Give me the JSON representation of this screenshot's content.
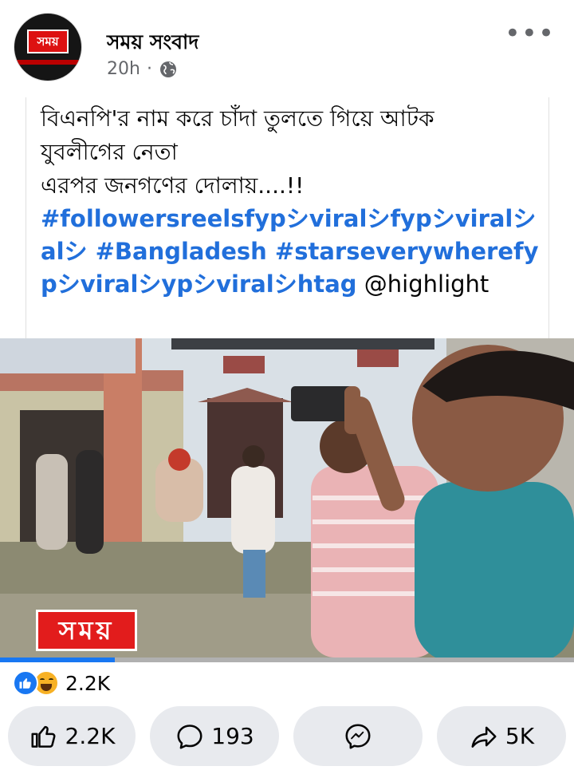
{
  "post": {
    "page_name": "সময় সংবাদ",
    "time": "20h",
    "separator": "·",
    "avatar_logo_text": "সময়",
    "caption_line1": "বিএনপি'র  নাম করে চাঁদা  তুলতে গিয়ে আটক",
    "caption_line2": "যুবলীগের নেতা",
    "caption_line3": "এরপর জনগণের দোলায়....!!",
    "hashtags_part1": "#followersreelsfypシviralシfypシviralシalシ #Bangladesh #starseverywherefypシviralシypシviralシhtag",
    "mention": " @highlight"
  },
  "video": {
    "watermark": "সময়",
    "progress": 0.2
  },
  "reactions": {
    "types": [
      "like-icon",
      "haha-icon"
    ],
    "count": "2.2K"
  },
  "actions": {
    "like_count": "2.2K",
    "comment_count": "193",
    "share_count": "5K"
  },
  "colors": {
    "accent": "#1877f2",
    "hashtag": "#216fdb",
    "muted": "#65676b",
    "button_bg": "#e8eaee"
  }
}
